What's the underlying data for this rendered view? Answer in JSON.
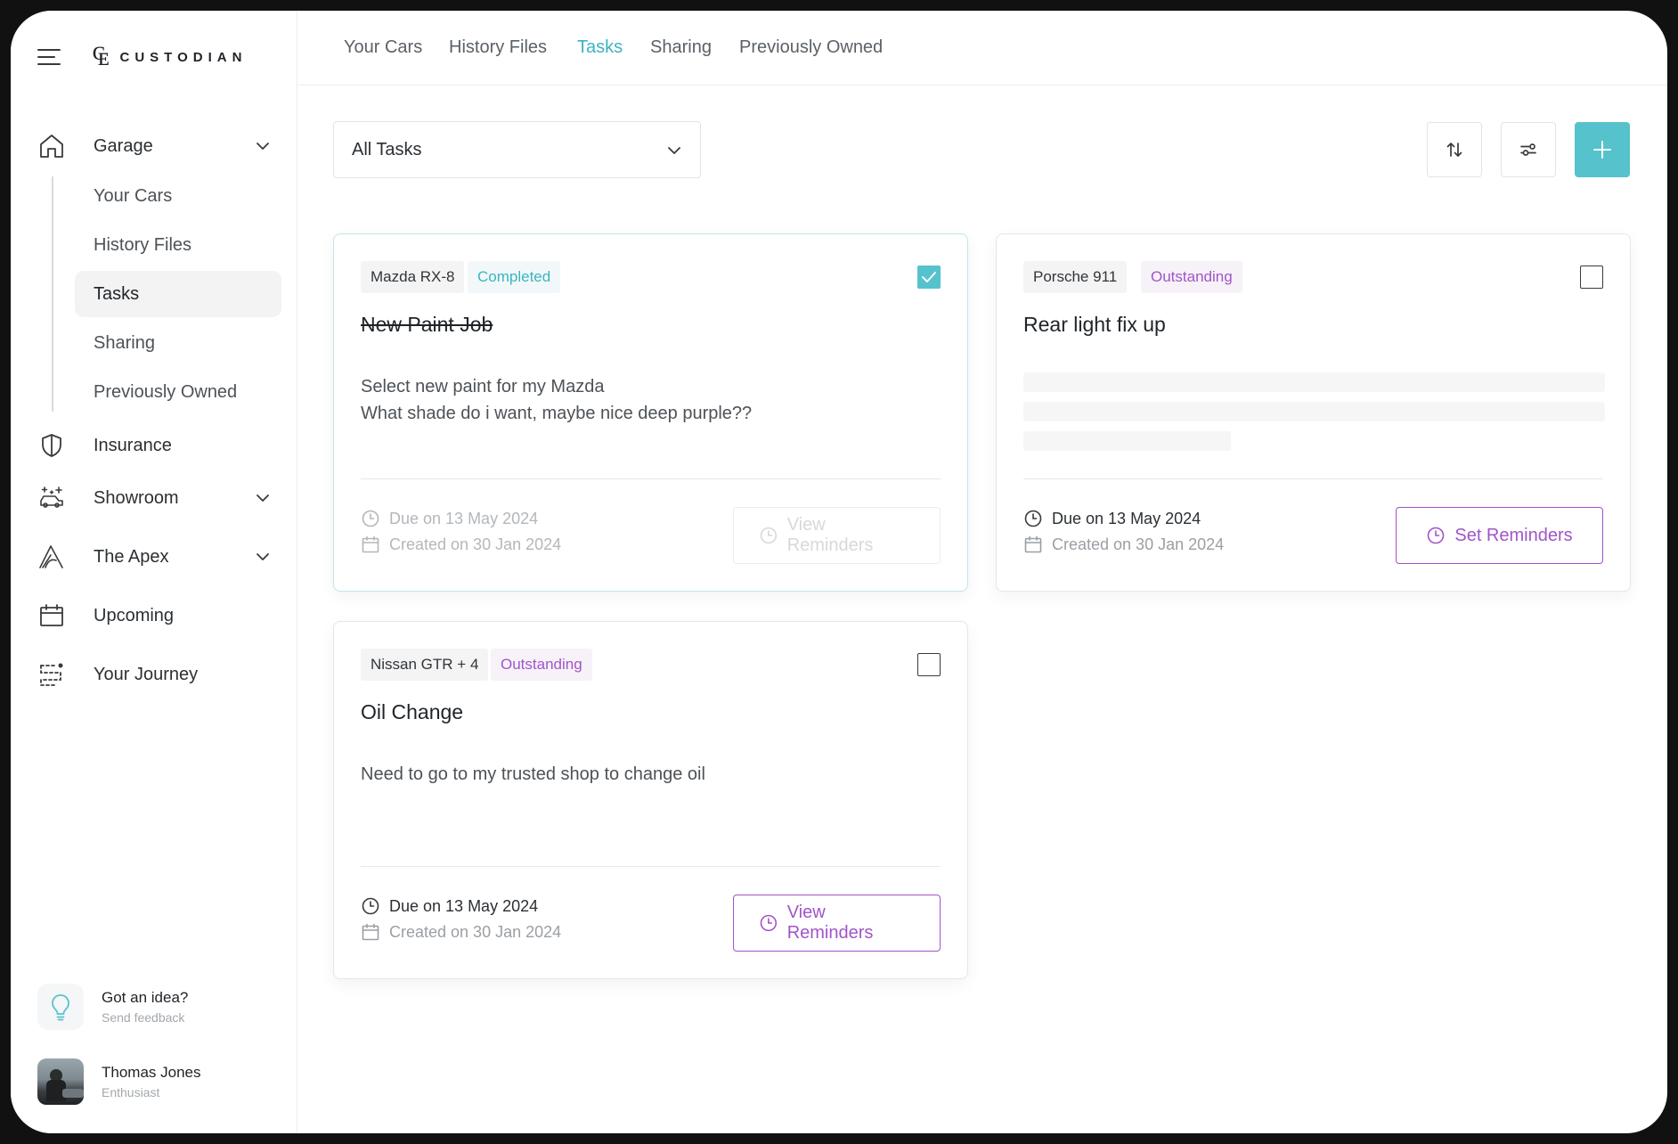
{
  "app": {
    "brand_name": "CUSTODIAN"
  },
  "top_tabs": [
    {
      "label": "Your Cars",
      "active": false
    },
    {
      "label": "History Files",
      "active": false
    },
    {
      "label": "Tasks",
      "active": true
    },
    {
      "label": "Sharing",
      "active": false
    },
    {
      "label": "Previously Owned",
      "active": false
    }
  ],
  "sidebar": {
    "garage": {
      "label": "Garage",
      "items": [
        {
          "label": "Your Cars",
          "active": false
        },
        {
          "label": "History Files",
          "active": false
        },
        {
          "label": "Tasks",
          "active": true
        },
        {
          "label": "Sharing",
          "active": false
        },
        {
          "label": "Previously Owned",
          "active": false
        }
      ]
    },
    "items": [
      {
        "label": "Insurance",
        "icon": "shield-icon",
        "expandable": false
      },
      {
        "label": "Showroom",
        "icon": "sparkle-car-icon",
        "expandable": true
      },
      {
        "label": "The Apex",
        "icon": "apex-icon",
        "expandable": true
      },
      {
        "label": "Upcoming",
        "icon": "calendar-icon",
        "expandable": false
      },
      {
        "label": "Your Journey",
        "icon": "journey-icon",
        "expandable": false
      }
    ],
    "feedback": {
      "title": "Got an idea?",
      "subtitle": "Send feedback"
    },
    "user": {
      "name": "Thomas Jones",
      "role": "Enthusiast"
    }
  },
  "toolbar": {
    "filter_value": "All Tasks"
  },
  "cards": [
    {
      "car": "Mazda RX-8",
      "status": "Completed",
      "checked": true,
      "title": "New Paint Job",
      "description_lines": [
        "Select new paint for my Mazda",
        "What shade do i want, maybe nice deep purple??"
      ],
      "due": "Due on 13 May 2024",
      "created": "Created on 30 Jan 2024",
      "button": "View Reminders"
    },
    {
      "car": "Porsche 911",
      "status": "Outstanding",
      "checked": false,
      "title": "Rear light fix up",
      "description_lines": [],
      "due": "Due on 13 May 2024",
      "created": "Created on 30 Jan 2024",
      "button": "Set Reminders"
    },
    {
      "car": "Nissan GTR + 4",
      "status": "Outstanding",
      "checked": false,
      "title": "Oil Change",
      "description_lines": [
        "Need to go to my trusted shop to change oil"
      ],
      "due": "Due on 13 May 2024",
      "created": "Created on 30 Jan 2024",
      "button": "View Reminders"
    }
  ],
  "colors": {
    "accent_teal": "#56c2cc",
    "accent_purple": "#a154c9",
    "text_dark": "#1f2328"
  }
}
